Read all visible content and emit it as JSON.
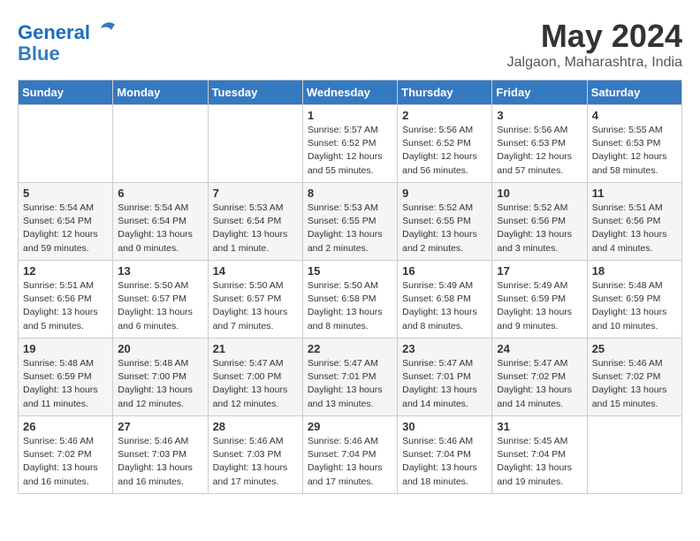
{
  "header": {
    "logo_line1": "General",
    "logo_line2": "Blue",
    "month_year": "May 2024",
    "location": "Jalgaon, Maharashtra, India"
  },
  "days_of_week": [
    "Sunday",
    "Monday",
    "Tuesday",
    "Wednesday",
    "Thursday",
    "Friday",
    "Saturday"
  ],
  "weeks": [
    [
      {
        "day": "",
        "info": ""
      },
      {
        "day": "",
        "info": ""
      },
      {
        "day": "",
        "info": ""
      },
      {
        "day": "1",
        "info": "Sunrise: 5:57 AM\nSunset: 6:52 PM\nDaylight: 12 hours\nand 55 minutes."
      },
      {
        "day": "2",
        "info": "Sunrise: 5:56 AM\nSunset: 6:52 PM\nDaylight: 12 hours\nand 56 minutes."
      },
      {
        "day": "3",
        "info": "Sunrise: 5:56 AM\nSunset: 6:53 PM\nDaylight: 12 hours\nand 57 minutes."
      },
      {
        "day": "4",
        "info": "Sunrise: 5:55 AM\nSunset: 6:53 PM\nDaylight: 12 hours\nand 58 minutes."
      }
    ],
    [
      {
        "day": "5",
        "info": "Sunrise: 5:54 AM\nSunset: 6:54 PM\nDaylight: 12 hours\nand 59 minutes."
      },
      {
        "day": "6",
        "info": "Sunrise: 5:54 AM\nSunset: 6:54 PM\nDaylight: 13 hours\nand 0 minutes."
      },
      {
        "day": "7",
        "info": "Sunrise: 5:53 AM\nSunset: 6:54 PM\nDaylight: 13 hours\nand 1 minute."
      },
      {
        "day": "8",
        "info": "Sunrise: 5:53 AM\nSunset: 6:55 PM\nDaylight: 13 hours\nand 2 minutes."
      },
      {
        "day": "9",
        "info": "Sunrise: 5:52 AM\nSunset: 6:55 PM\nDaylight: 13 hours\nand 2 minutes."
      },
      {
        "day": "10",
        "info": "Sunrise: 5:52 AM\nSunset: 6:56 PM\nDaylight: 13 hours\nand 3 minutes."
      },
      {
        "day": "11",
        "info": "Sunrise: 5:51 AM\nSunset: 6:56 PM\nDaylight: 13 hours\nand 4 minutes."
      }
    ],
    [
      {
        "day": "12",
        "info": "Sunrise: 5:51 AM\nSunset: 6:56 PM\nDaylight: 13 hours\nand 5 minutes."
      },
      {
        "day": "13",
        "info": "Sunrise: 5:50 AM\nSunset: 6:57 PM\nDaylight: 13 hours\nand 6 minutes."
      },
      {
        "day": "14",
        "info": "Sunrise: 5:50 AM\nSunset: 6:57 PM\nDaylight: 13 hours\nand 7 minutes."
      },
      {
        "day": "15",
        "info": "Sunrise: 5:50 AM\nSunset: 6:58 PM\nDaylight: 13 hours\nand 8 minutes."
      },
      {
        "day": "16",
        "info": "Sunrise: 5:49 AM\nSunset: 6:58 PM\nDaylight: 13 hours\nand 8 minutes."
      },
      {
        "day": "17",
        "info": "Sunrise: 5:49 AM\nSunset: 6:59 PM\nDaylight: 13 hours\nand 9 minutes."
      },
      {
        "day": "18",
        "info": "Sunrise: 5:48 AM\nSunset: 6:59 PM\nDaylight: 13 hours\nand 10 minutes."
      }
    ],
    [
      {
        "day": "19",
        "info": "Sunrise: 5:48 AM\nSunset: 6:59 PM\nDaylight: 13 hours\nand 11 minutes."
      },
      {
        "day": "20",
        "info": "Sunrise: 5:48 AM\nSunset: 7:00 PM\nDaylight: 13 hours\nand 12 minutes."
      },
      {
        "day": "21",
        "info": "Sunrise: 5:47 AM\nSunset: 7:00 PM\nDaylight: 13 hours\nand 12 minutes."
      },
      {
        "day": "22",
        "info": "Sunrise: 5:47 AM\nSunset: 7:01 PM\nDaylight: 13 hours\nand 13 minutes."
      },
      {
        "day": "23",
        "info": "Sunrise: 5:47 AM\nSunset: 7:01 PM\nDaylight: 13 hours\nand 14 minutes."
      },
      {
        "day": "24",
        "info": "Sunrise: 5:47 AM\nSunset: 7:02 PM\nDaylight: 13 hours\nand 14 minutes."
      },
      {
        "day": "25",
        "info": "Sunrise: 5:46 AM\nSunset: 7:02 PM\nDaylight: 13 hours\nand 15 minutes."
      }
    ],
    [
      {
        "day": "26",
        "info": "Sunrise: 5:46 AM\nSunset: 7:02 PM\nDaylight: 13 hours\nand 16 minutes."
      },
      {
        "day": "27",
        "info": "Sunrise: 5:46 AM\nSunset: 7:03 PM\nDaylight: 13 hours\nand 16 minutes."
      },
      {
        "day": "28",
        "info": "Sunrise: 5:46 AM\nSunset: 7:03 PM\nDaylight: 13 hours\nand 17 minutes."
      },
      {
        "day": "29",
        "info": "Sunrise: 5:46 AM\nSunset: 7:04 PM\nDaylight: 13 hours\nand 17 minutes."
      },
      {
        "day": "30",
        "info": "Sunrise: 5:46 AM\nSunset: 7:04 PM\nDaylight: 13 hours\nand 18 minutes."
      },
      {
        "day": "31",
        "info": "Sunrise: 5:45 AM\nSunset: 7:04 PM\nDaylight: 13 hours\nand 19 minutes."
      },
      {
        "day": "",
        "info": ""
      }
    ]
  ]
}
